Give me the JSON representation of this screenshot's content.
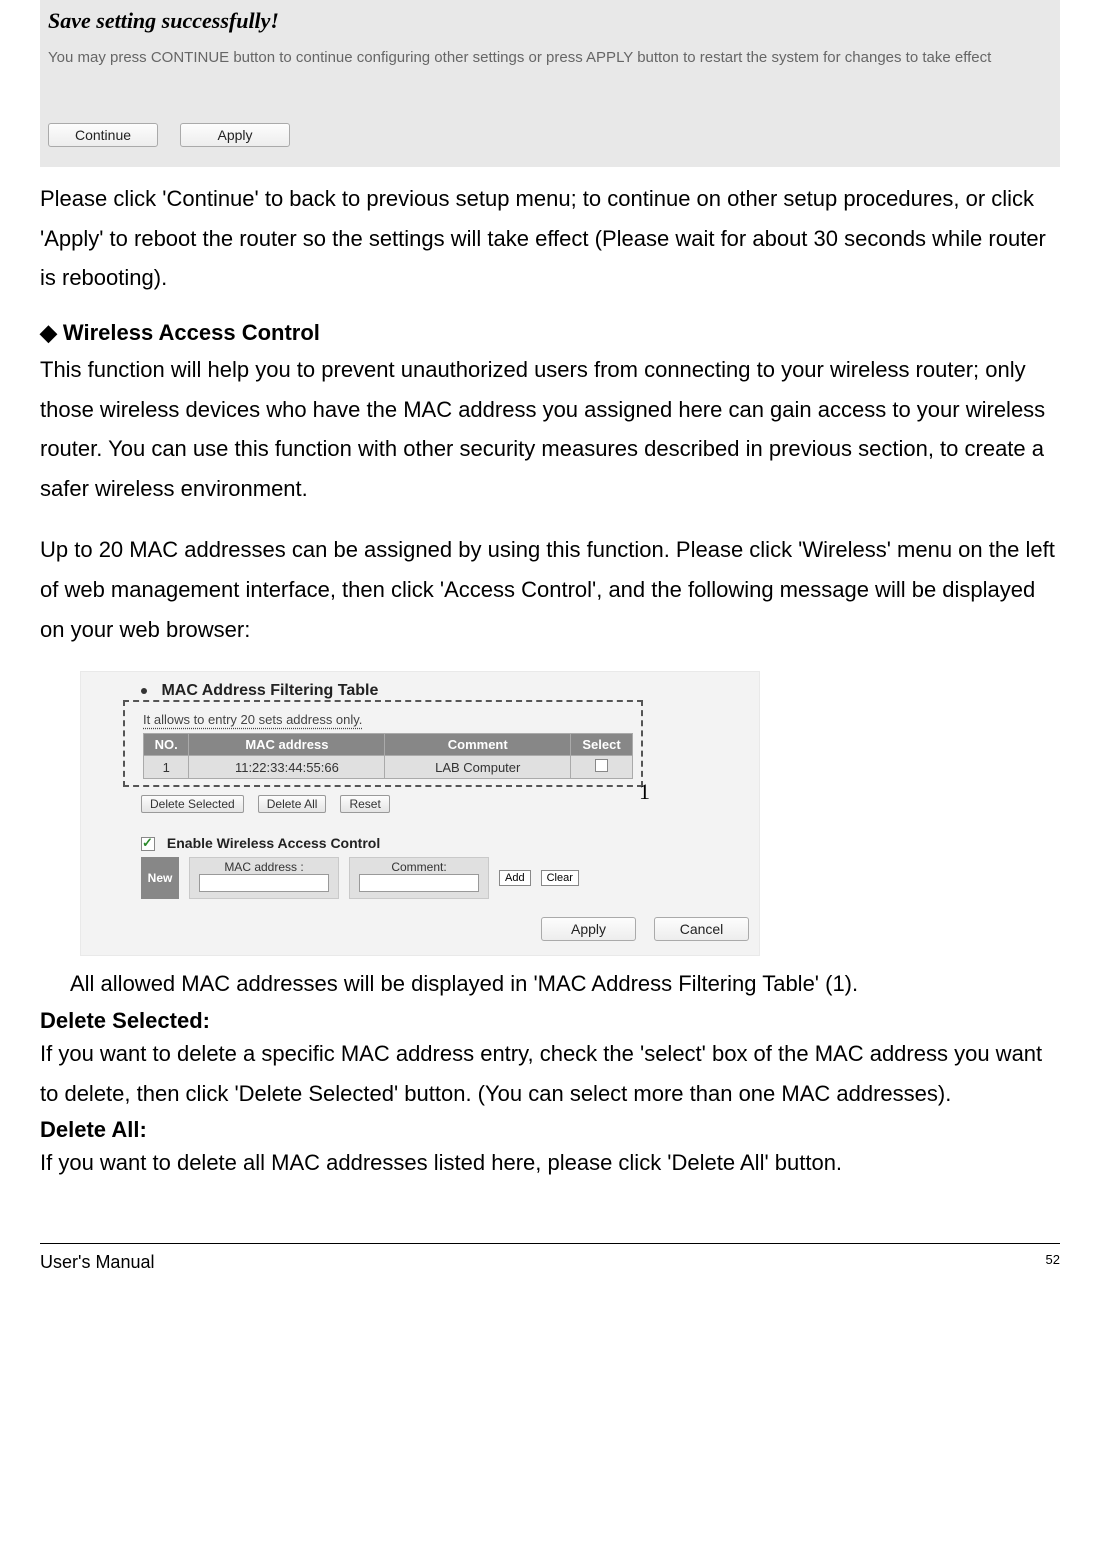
{
  "save_panel": {
    "title": "Save setting successfully!",
    "description": "You may press CONTINUE button to continue configuring other settings or press APPLY button to restart the system for changes to take effect",
    "continue_label": "Continue",
    "apply_label": "Apply"
  },
  "p1": "Please click 'Continue' to back to previous setup menu; to continue on other setup procedures, or click 'Apply' to reboot the router so the settings will take effect (Please wait for about 30 seconds while router is rebooting).",
  "section": {
    "heading": "Wireless Access Control",
    "p2": "This function will help you to prevent unauthorized users from connecting to your wireless router; only those wireless devices who have the MAC address you assigned here can gain access to your wireless router. You can use this function with other security measures described in previous section, to create a safer wireless environment.",
    "p3": "Up to 20 MAC addresses can be assigned by using this function. Please click 'Wireless' menu on the left of web management interface, then click 'Access Control', and the following message will be displayed on your web browser:"
  },
  "fig2": {
    "title": "MAC Address Filtering Table",
    "subtitle": "It allows to entry 20 sets address only.",
    "columns": {
      "no": "NO.",
      "mac": "MAC address",
      "comment": "Comment",
      "select": "Select"
    },
    "row": {
      "no": "1",
      "mac": "11:22:33:44:55:66",
      "comment": "LAB Computer"
    },
    "delete_selected": "Delete Selected",
    "delete_all": "Delete All",
    "reset": "Reset",
    "enable_label": "Enable Wireless Access Control",
    "new_label": "New",
    "mac_label": "MAC address :",
    "comment_label": "Comment:",
    "add": "Add",
    "clear": "Clear",
    "apply": "Apply",
    "cancel": "Cancel",
    "callout": "1"
  },
  "p4": "All allowed MAC addresses will be displayed in 'MAC Address Filtering Table' (1).",
  "delete_selected_h": "Delete Selected:",
  "p5": "If you want to delete a specific MAC address entry, check the 'select' box of the MAC address you want to delete, then click 'Delete Selected' button. (You can select more than one MAC addresses).",
  "delete_all_h": "Delete All:",
  "p6": "If you want to delete all MAC addresses listed here, please click 'Delete All' button.",
  "footer": {
    "manual": "User's Manual",
    "page": "52"
  }
}
